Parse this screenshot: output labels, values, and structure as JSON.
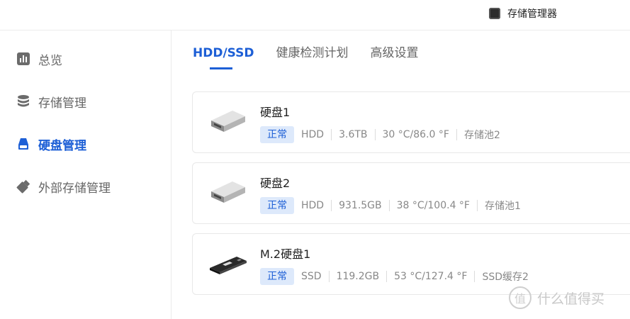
{
  "app": {
    "title": "存储管理器",
    "icon": "storage-manager-icon"
  },
  "sidebar": {
    "items": [
      {
        "label": "总览",
        "icon": "bar-chart-icon",
        "active": false
      },
      {
        "label": "存储管理",
        "icon": "database-stack-icon",
        "active": false
      },
      {
        "label": "硬盘管理",
        "icon": "drive-icon",
        "active": true
      },
      {
        "label": "外部存储管理",
        "icon": "usb-drive-icon",
        "active": false
      }
    ]
  },
  "tabs": [
    {
      "label": "HDD/SSD",
      "active": true
    },
    {
      "label": "健康检测计划",
      "active": false
    },
    {
      "label": "高级设置",
      "active": false
    }
  ],
  "disks": [
    {
      "name": "硬盘1",
      "status": "正常",
      "type": "HDD",
      "size": "3.6TB",
      "temp": "30 °C/86.0 °F",
      "pool": "存储池2",
      "image": "hdd-icon"
    },
    {
      "name": "硬盘2",
      "status": "正常",
      "type": "HDD",
      "size": "931.5GB",
      "temp": "38 °C/100.4 °F",
      "pool": "存储池1",
      "image": "hdd-icon"
    },
    {
      "name": "M.2硬盘1",
      "status": "正常",
      "type": "SSD",
      "size": "119.2GB",
      "temp": "53 °C/127.4 °F",
      "pool": "SSD缓存2",
      "image": "m2-ssd-icon"
    }
  ],
  "watermark": {
    "glyph": "值",
    "text": "什么值得买"
  },
  "colors": {
    "accent": "#1d5fd6",
    "badge_bg": "#dde9fb"
  }
}
